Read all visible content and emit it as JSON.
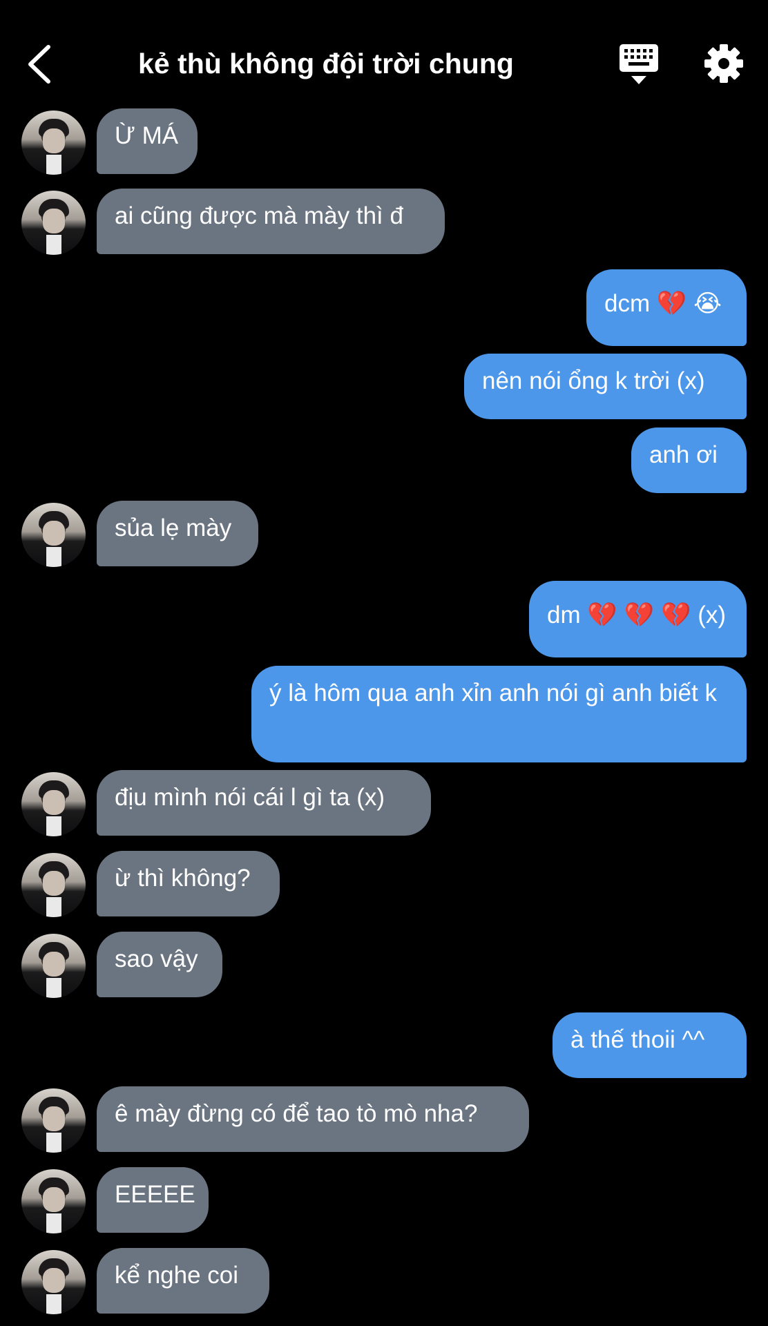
{
  "header": {
    "title": "kẻ thù không đội trời chung",
    "back_icon": "chevron-left-icon",
    "keyboard_icon": "keyboard-dismiss-icon",
    "settings_icon": "gear-icon"
  },
  "colors": {
    "background": "#000000",
    "incoming_bubble": "#6b7581",
    "outgoing_bubble": "#4c97ea",
    "text": "#ffffff"
  },
  "messages": [
    {
      "dir": "in",
      "text": "Ừ MÁ"
    },
    {
      "dir": "in",
      "text": "ai cũng được mà mày thì đ"
    },
    {
      "dir": "out",
      "text": "dcm 💔 😭"
    },
    {
      "dir": "out",
      "text": "nên nói ổng k trời (x)"
    },
    {
      "dir": "out",
      "text": "anh ơi"
    },
    {
      "dir": "in",
      "text": "sủa lẹ mày"
    },
    {
      "dir": "out",
      "text": "dm 💔 💔 💔  (x)"
    },
    {
      "dir": "out",
      "text": "ý là hôm qua anh xỉn anh nói gì anh biết k"
    },
    {
      "dir": "in",
      "text": "địu mình nói cái l gì ta (x)"
    },
    {
      "dir": "in",
      "text": "ừ thì không?"
    },
    {
      "dir": "in",
      "text": "sao vậy"
    },
    {
      "dir": "out",
      "text": "à thế thoii ^^"
    },
    {
      "dir": "in",
      "text": "ê mày đừng có để tao tò mò nha?"
    },
    {
      "dir": "in",
      "text": "EEEEE"
    },
    {
      "dir": "in",
      "text": "kể nghe coi"
    }
  ]
}
